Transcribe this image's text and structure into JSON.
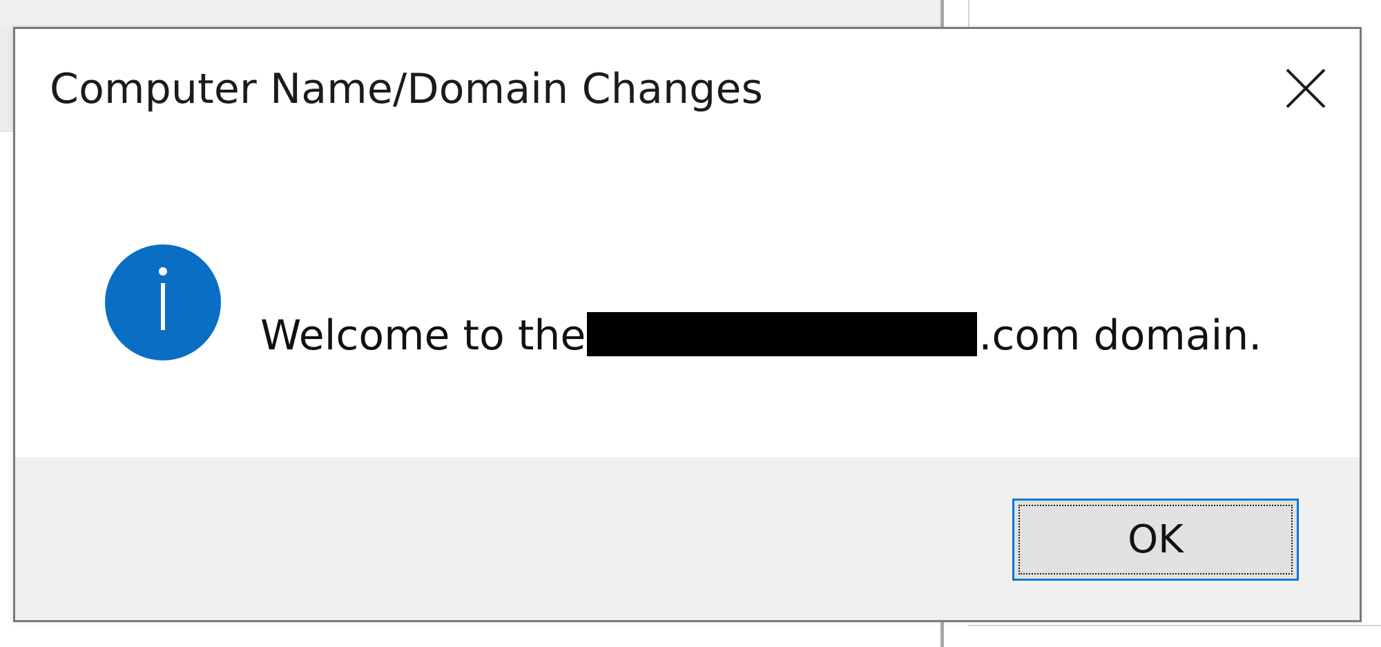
{
  "dialog": {
    "title": "Computer Name/Domain Changes",
    "close_icon": "close-icon",
    "message": {
      "icon": "info-icon",
      "prefix": "Welcome to the",
      "suffix": ".com domain."
    },
    "ok_label": "OK"
  },
  "colors": {
    "accent": "#0078d7",
    "info_icon": "#0a6fc4",
    "footer_bg": "#f0f0f0",
    "button_bg": "#e1e1e1"
  }
}
